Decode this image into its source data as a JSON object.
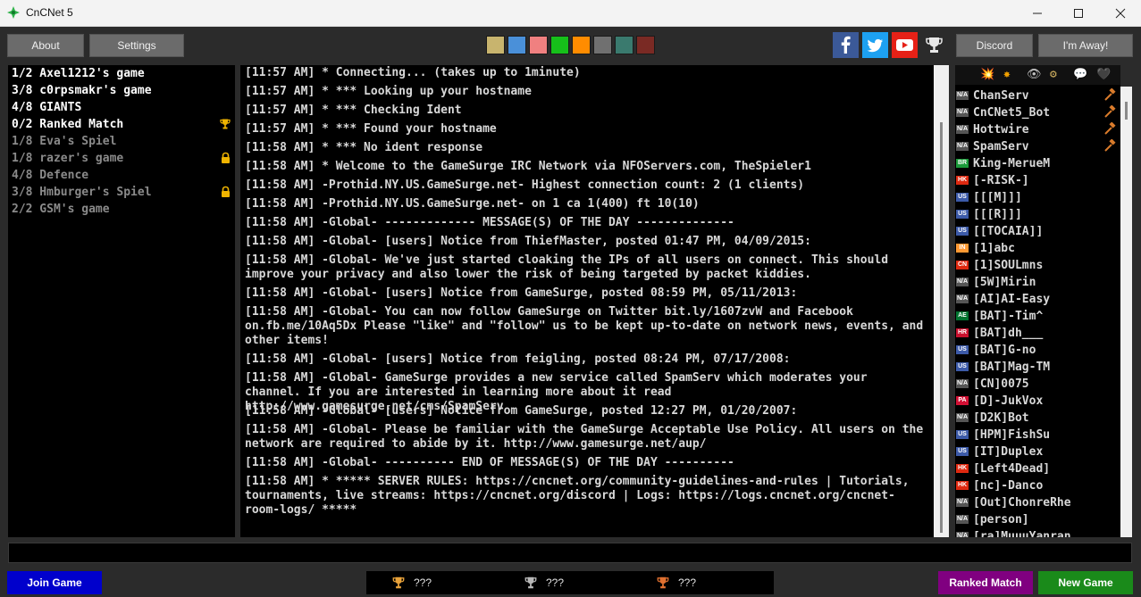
{
  "window": {
    "title": "CnCNet 5"
  },
  "toolbar": {
    "about_label": "About",
    "settings_label": "Settings",
    "discord_label": "Discord",
    "away_label": "I'm Away!",
    "color_swatches": [
      "#c8b46e",
      "#4a90d9",
      "#f08080",
      "#16c01a",
      "#ff8c00",
      "#707070",
      "#3a7a6e",
      "#7a2a24"
    ]
  },
  "games": [
    {
      "name": "1/2 Axel1212's game",
      "color": "#ffffff",
      "badge": ""
    },
    {
      "name": "3/8 c0rpsmakr's game",
      "color": "#ffffff",
      "badge": ""
    },
    {
      "name": "4/8 GIANTS",
      "color": "#ffffff",
      "badge": ""
    },
    {
      "name": "0/2 Ranked Match",
      "color": "#ffffff",
      "badge": "trophy-icon"
    },
    {
      "name": "1/8 Eva's Spiel",
      "color": "#8a8a8a",
      "badge": ""
    },
    {
      "name": "1/8 razer's game",
      "color": "#8a8a8a",
      "badge": "lock-icon"
    },
    {
      "name": "4/8 Defence",
      "color": "#8a8a8a",
      "badge": ""
    },
    {
      "name": "3/8 Hmburger's Spiel",
      "color": "#8a8a8a",
      "badge": "lock-icon"
    },
    {
      "name": "2/2 GSM's game",
      "color": "#8a8a8a",
      "badge": ""
    }
  ],
  "chat": [
    "[11:57 AM] * Connecting... (takes up to 1minute)",
    "[11:57 AM] * *** Looking up your hostname",
    "[11:57 AM] * *** Checking Ident",
    "[11:57 AM] * *** Found your hostname",
    "[11:58 AM] * *** No ident response",
    "[11:58 AM] * Welcome to the GameSurge IRC Network via NFOServers.com, TheSpieler1",
    "[11:58 AM] -Prothid.NY.US.GameSurge.net- Highest connection count: 2 (1 clients)",
    "[11:58 AM] -Prothid.NY.US.GameSurge.net- on 1 ca 1(400) ft 10(10)",
    "[11:58 AM] -Global- ------------- MESSAGE(S) OF THE DAY --------------",
    "[11:58 AM] -Global- [users] Notice from ThiefMaster, posted 01:47 PM, 04/09/2015:",
    "[11:58 AM] -Global- We've just started cloaking the IPs of all users on connect. This should improve your privacy and also lower the risk of being targeted by packet kiddies.",
    "[11:58 AM] -Global- [users] Notice from GameSurge, posted 08:59 PM, 05/11/2013:",
    "[11:58 AM] -Global- You can now follow GameSurge on Twitter bit.ly/1607zvW and Facebook on.fb.me/10Aq5Dx Please \"like\" and \"follow\" us to be kept up-to-date on network news, events, and other items!",
    "[11:58 AM] -Global- [users] Notice from feigling, posted 08:24 PM, 07/17/2008:",
    "[11:58 AM] -Global- GameSurge provides a new service called SpamServ which moderates your channel. If you are interested in learning more about it read http://www.gamesurge.net/cms/SpamServ",
    "[11:58 AM] -Global- [users] Notice from GameSurge, posted 12:27 PM, 01/20/2007:",
    "[11:58 AM] -Global- Please be familiar with the GameSurge Acceptable Use Policy. All users on the network are required to abide by it. http://www.gamesurge.net/aup/",
    "[11:58 AM] -Global- ---------- END OF MESSAGE(S) OF THE DAY ----------",
    "[11:58 AM] * ***** SERVER RULES: https://cncnet.org/community-guidelines-and-rules | Tutorials, tournaments, live streams: https://cncnet.org/discord | Logs: https://logs.cncnet.org/cncnet-room-logs/ *****"
  ],
  "user_filter_icons": [
    "💥",
    "✸",
    "👁",
    "⚙",
    "💬",
    "🖤"
  ],
  "users": [
    {
      "name": "ChanServ",
      "flag": "N/A",
      "flag_color": "#555555",
      "op": true
    },
    {
      "name": "CnCNet5_Bot",
      "flag": "N/A",
      "flag_color": "#555555",
      "op": true
    },
    {
      "name": "Hottwire",
      "flag": "N/A",
      "flag_color": "#555555",
      "op": true
    },
    {
      "name": "SpamServ",
      "flag": "N/A",
      "flag_color": "#555555",
      "op": true
    },
    {
      "name": "King-MerueM",
      "flag": "BR",
      "flag_color": "#1b9a3a",
      "op": false
    },
    {
      "name": "[-RISK-]",
      "flag": "HK",
      "flag_color": "#de2910",
      "op": false
    },
    {
      "name": "[[[M]]]",
      "flag": "US",
      "flag_color": "#3c5aa8",
      "op": false
    },
    {
      "name": "[[[R]]]",
      "flag": "US",
      "flag_color": "#3c5aa8",
      "op": false
    },
    {
      "name": "[[TOCAIA]]",
      "flag": "US",
      "flag_color": "#3c5aa8",
      "op": false
    },
    {
      "name": "[1]abc",
      "flag": "IN",
      "flag_color": "#ff9933",
      "op": false
    },
    {
      "name": "[1]SOULmns",
      "flag": "CN",
      "flag_color": "#de2910",
      "op": false
    },
    {
      "name": "[5W]Mirin",
      "flag": "N/A",
      "flag_color": "#555555",
      "op": false
    },
    {
      "name": "[AI]AI-Easy",
      "flag": "N/A",
      "flag_color": "#555555",
      "op": false
    },
    {
      "name": "[BAT]-Tim^",
      "flag": "AE",
      "flag_color": "#00732f",
      "op": false
    },
    {
      "name": "[BAT]dh___",
      "flag": "HR",
      "flag_color": "#c8102e",
      "op": false
    },
    {
      "name": "[BAT]G-no",
      "flag": "US",
      "flag_color": "#3c5aa8",
      "op": false
    },
    {
      "name": "[BAT]Mag-TM",
      "flag": "US",
      "flag_color": "#3c5aa8",
      "op": false
    },
    {
      "name": "[CN]0075",
      "flag": "N/A",
      "flag_color": "#555555",
      "op": false
    },
    {
      "name": "[D]-JukVox",
      "flag": "PA",
      "flag_color": "#d21034",
      "op": false
    },
    {
      "name": "[D2K]Bot",
      "flag": "N/A",
      "flag_color": "#555555",
      "op": false
    },
    {
      "name": "[HPM]FishSu",
      "flag": "US",
      "flag_color": "#3c5aa8",
      "op": false
    },
    {
      "name": "[IT]Duplex",
      "flag": "US",
      "flag_color": "#3c5aa8",
      "op": false
    },
    {
      "name": "[Left4Dead]",
      "flag": "HK",
      "flag_color": "#de2910",
      "op": false
    },
    {
      "name": "[nc]-Danco",
      "flag": "HK",
      "flag_color": "#de2910",
      "op": false
    },
    {
      "name": "[Out]ChonreRhe",
      "flag": "N/A",
      "flag_color": "#555555",
      "op": false
    },
    {
      "name": "[person]",
      "flag": "N/A",
      "flag_color": "#555555",
      "op": false
    },
    {
      "name": "[ra]MuuuYanran",
      "flag": "N/A",
      "flag_color": "#555555",
      "op": false
    }
  ],
  "bottom": {
    "join_label": "Join Game",
    "ranked_label": "Ranked Match",
    "new_game_label": "New Game",
    "ladder": [
      {
        "value": "???",
        "trophy_color": "#e8a23a"
      },
      {
        "value": "???",
        "trophy_color": "#b8b8b8"
      },
      {
        "value": "???",
        "trophy_color": "#e07030"
      }
    ]
  }
}
